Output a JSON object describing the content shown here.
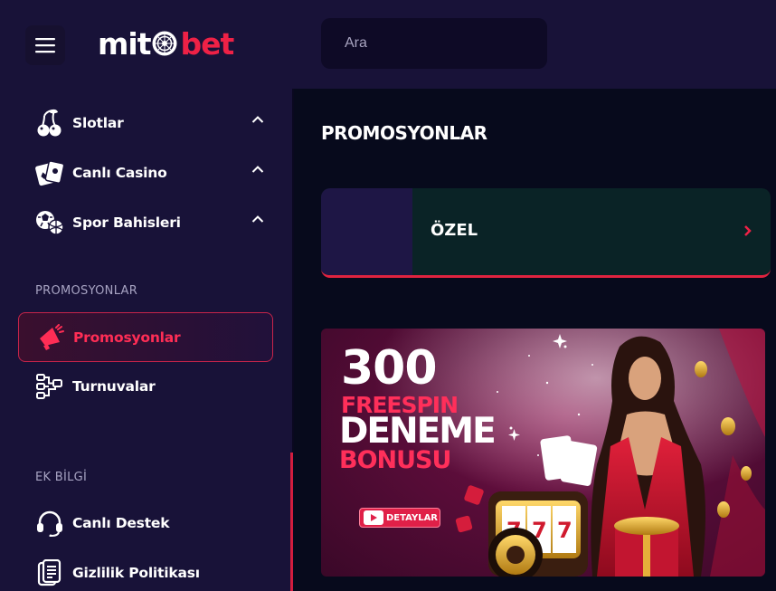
{
  "header": {
    "logo_part1": "mit",
    "logo_part2": "bet",
    "search_placeholder": "Ara"
  },
  "sidebar": {
    "games": [
      {
        "label": "Slotlar",
        "icon": "cherries-icon"
      },
      {
        "label": "Canlı Casino",
        "icon": "playing-cards-icon"
      },
      {
        "label": "Spor Bahisleri",
        "icon": "sports-balls-icon"
      }
    ],
    "promos_title": "PROMOSYONLAR",
    "promos": [
      {
        "label": "Promosyonlar",
        "icon": "megaphone-icon",
        "active": true
      },
      {
        "label": "Turnuvalar",
        "icon": "tournament-bracket-icon",
        "active": false
      }
    ],
    "info_title": "EK BİLGİ",
    "info": [
      {
        "label": "Canlı Destek",
        "icon": "headset-icon"
      },
      {
        "label": "Gizlilik Politikası",
        "icon": "document-icon"
      }
    ]
  },
  "main": {
    "page_title": "PROMOSYONLAR",
    "category": {
      "label": "ÖZEL"
    },
    "banner": {
      "line1": "300",
      "line2": "FREESPIN",
      "line3": "DENEME",
      "line4": "BONUSU",
      "button_label": "DETAYLAR"
    }
  },
  "colors": {
    "accent": "#ee2146",
    "sidebar_bg": "#181238",
    "page_bg": "#070a1c",
    "category_bg": "#0a2326"
  }
}
